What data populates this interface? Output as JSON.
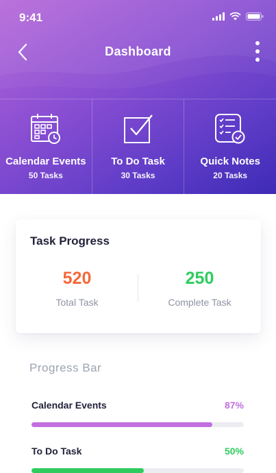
{
  "status_bar": {
    "time": "9:41"
  },
  "nav": {
    "title": "Dashboard"
  },
  "tiles": [
    {
      "label": "Calendar Events",
      "count": "50 Tasks",
      "icon": "calendar-icon"
    },
    {
      "label": "To Do Task",
      "count": "30 Tasks",
      "icon": "checkbox-icon"
    },
    {
      "label": "Quick Notes",
      "count": "20 Tasks",
      "icon": "checklist-icon"
    }
  ],
  "task_progress": {
    "title": "Task Progress",
    "stats": [
      {
        "value": "520",
        "label": "Total Task",
        "color": "#f4683a"
      },
      {
        "value": "250",
        "label": "Complete Task",
        "color": "#2ecc5e"
      }
    ]
  },
  "progress_bar": {
    "title": "Progress Bar",
    "items": [
      {
        "label": "Calendar Events",
        "percent_text": "87%",
        "fraction": 0.85,
        "color": "#c26ee0"
      },
      {
        "label": "To Do Task",
        "percent_text": "50%",
        "fraction": 0.53,
        "color": "#2ecc5e"
      }
    ]
  },
  "colors": {
    "header_gradient": [
      "#b566d8",
      "#3d2bb6"
    ],
    "text_dark": "#22223a",
    "text_muted": "#8f93a3"
  }
}
